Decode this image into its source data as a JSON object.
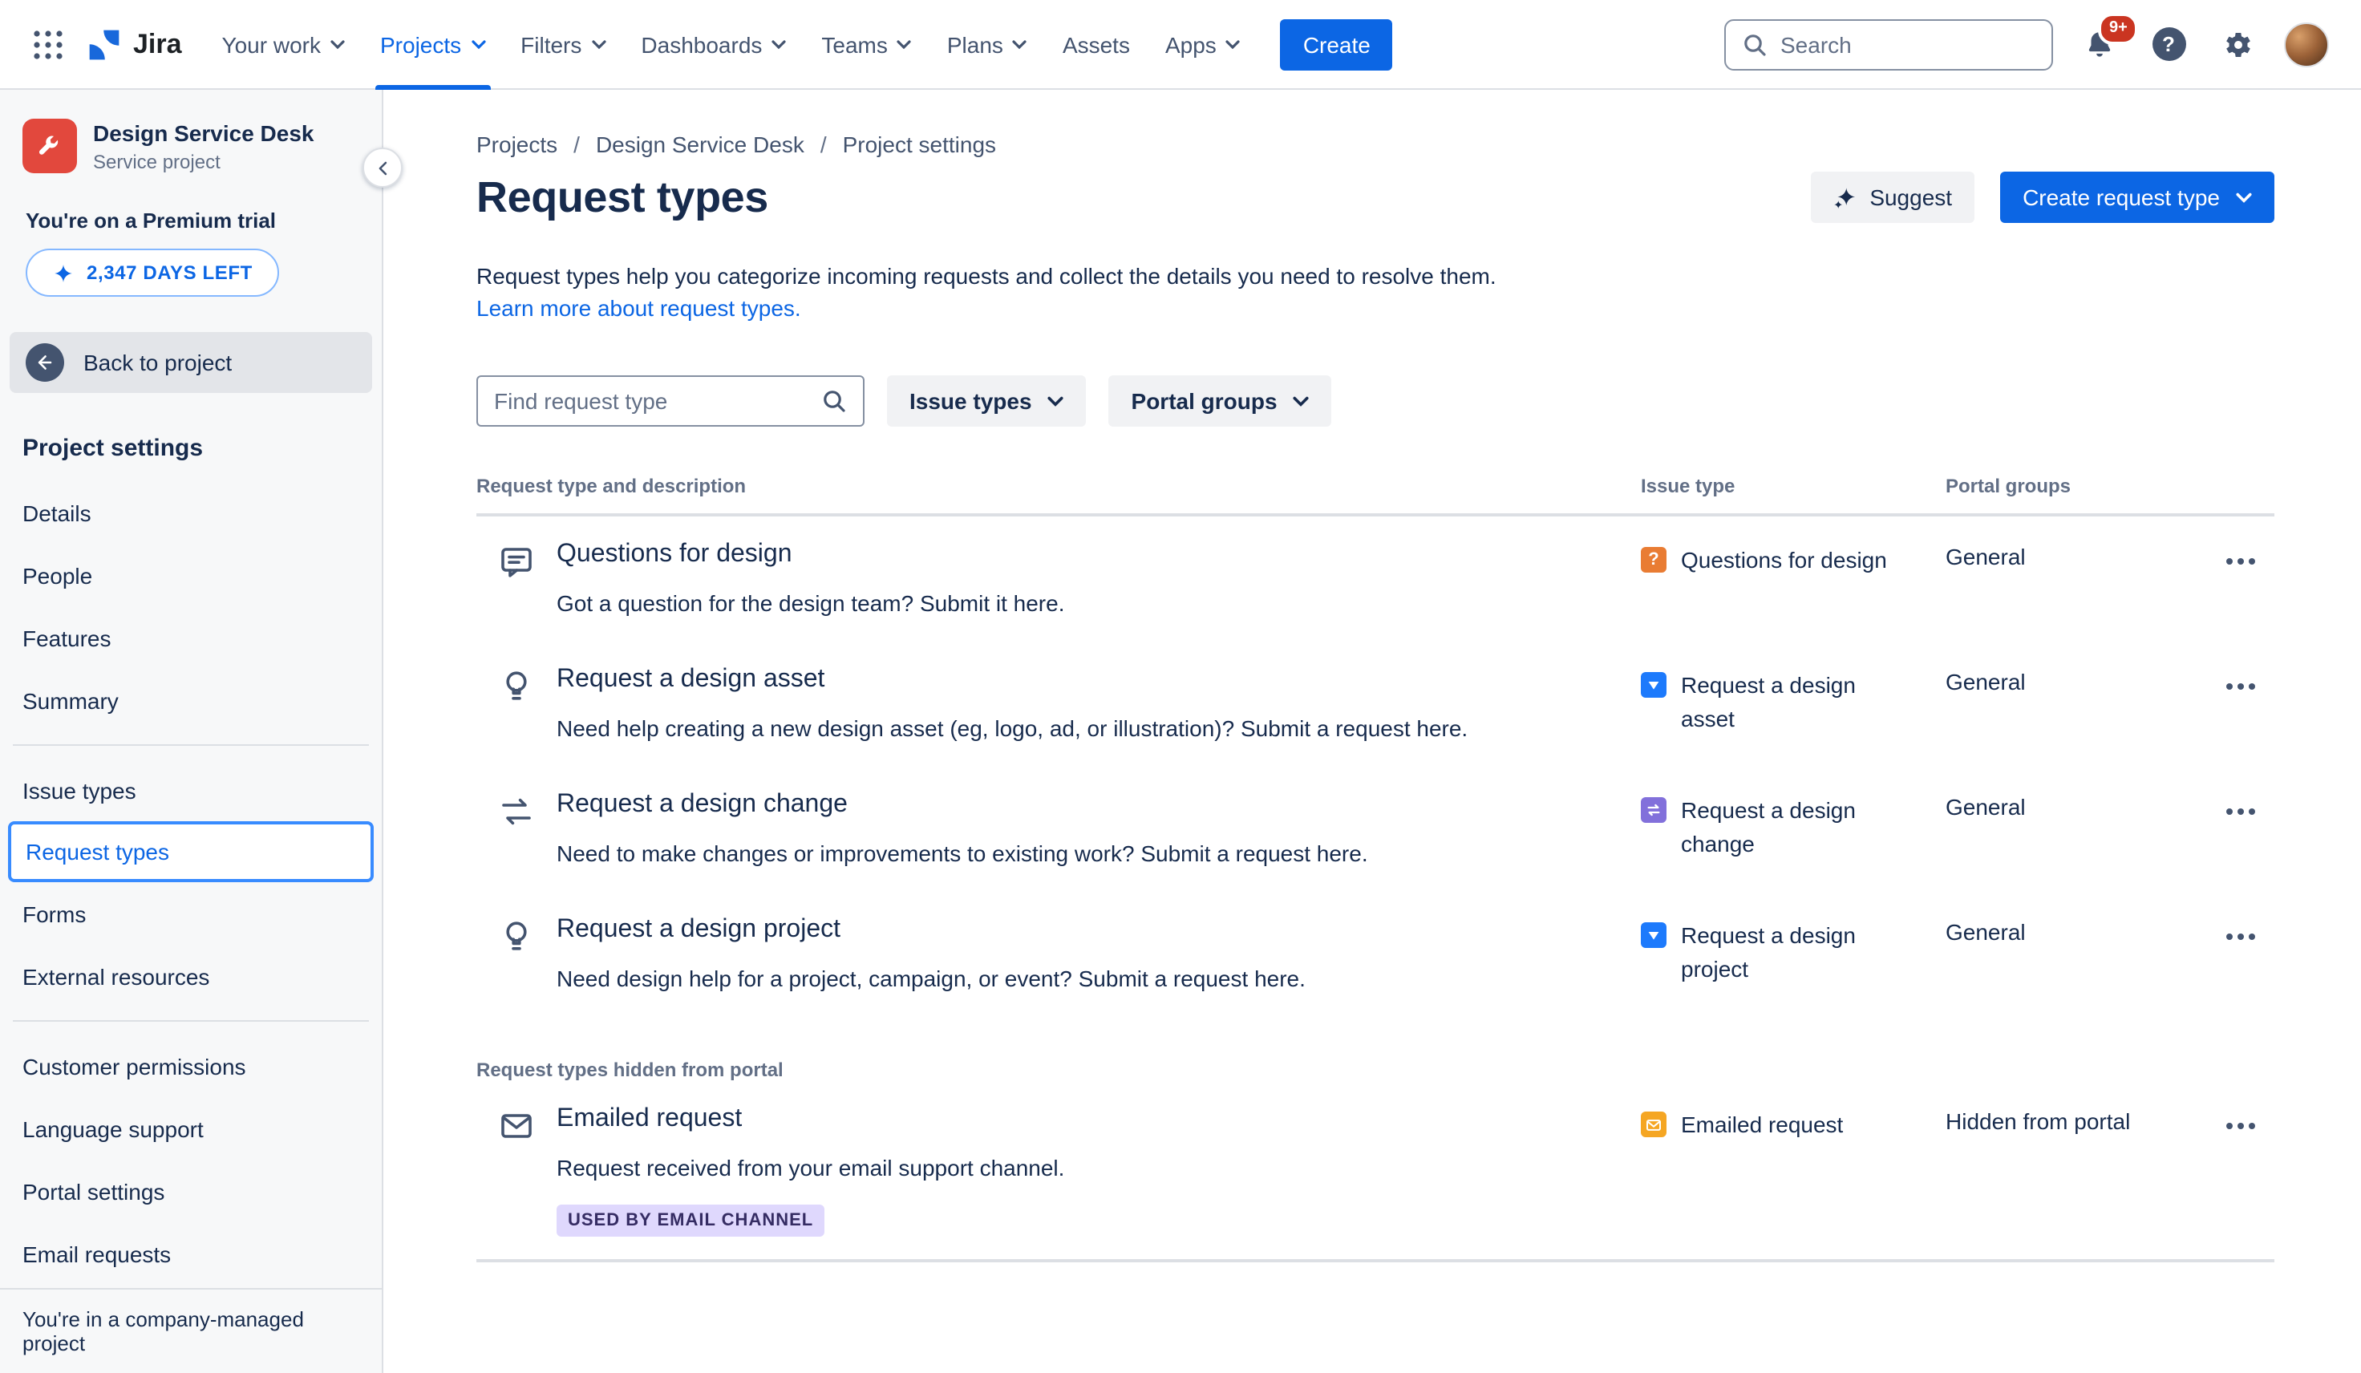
{
  "topbar": {
    "logo_text": "Jira",
    "nav": [
      {
        "label": "Your work"
      },
      {
        "label": "Projects"
      },
      {
        "label": "Filters"
      },
      {
        "label": "Dashboards"
      },
      {
        "label": "Teams"
      },
      {
        "label": "Plans"
      },
      {
        "label": "Assets"
      },
      {
        "label": "Apps"
      }
    ],
    "create_label": "Create",
    "search_placeholder": "Search",
    "notification_count": "9+"
  },
  "sidebar": {
    "project_name": "Design Service Desk",
    "project_type": "Service project",
    "trial_text": "You're on a Premium trial",
    "trial_days_label": "2,347 DAYS LEFT",
    "back_label": "Back to project",
    "settings_heading": "Project settings",
    "nav_groups": [
      {
        "items": [
          {
            "label": "Details"
          },
          {
            "label": "People"
          },
          {
            "label": "Features"
          },
          {
            "label": "Summary"
          }
        ]
      },
      {
        "items": [
          {
            "label": "Issue types"
          },
          {
            "label": "Request types",
            "selected": true
          },
          {
            "label": "Forms"
          },
          {
            "label": "External resources"
          }
        ]
      },
      {
        "items": [
          {
            "label": "Customer permissions"
          },
          {
            "label": "Language support"
          },
          {
            "label": "Portal settings"
          },
          {
            "label": "Email requests"
          }
        ]
      }
    ],
    "footer_note": "You're in a company-managed project"
  },
  "main": {
    "breadcrumbs": [
      {
        "label": "Projects"
      },
      {
        "label": "Design Service Desk"
      },
      {
        "label": "Project settings"
      }
    ],
    "title": "Request types",
    "suggest_label": "Suggest",
    "create_request_label": "Create request type",
    "intro": "Request types help you categorize incoming requests and collect the details you need to resolve them.",
    "learn_more_link": "Learn more about request types.",
    "filters": {
      "find_placeholder": "Find request type",
      "issue_types_label": "Issue types",
      "portal_groups_label": "Portal groups"
    },
    "table": {
      "headers": [
        "Request type and description",
        "Issue type",
        "Portal groups"
      ],
      "rows": [
        {
          "name": "Questions for design",
          "description": "Got a question for the design team? Submit it here.",
          "issue_type": "Questions for design",
          "issue_icon_glyph": "?",
          "portal_group": "General"
        },
        {
          "name": "Request a design asset",
          "description": "Need help creating a new design asset (eg, logo, ad, or illustration)? Submit a request here.",
          "issue_type": "Request a design asset",
          "portal_group": "General"
        },
        {
          "name": "Request a design change",
          "description": "Need to make changes or improvements to existing work? Submit a request here.",
          "issue_type": "Request a design change",
          "portal_group": "General"
        },
        {
          "name": "Request a design project",
          "description": "Need design help for a project, campaign, or event? Submit a request here.",
          "issue_type": "Request a design project",
          "portal_group": "General"
        }
      ],
      "hidden_section_label": "Request types hidden from portal",
      "hidden_rows": [
        {
          "name": "Emailed request",
          "description": "Request received from your email support channel.",
          "badge": "USED BY EMAIL CHANNEL",
          "issue_type": "Emailed request",
          "portal_group": "Hidden from portal"
        }
      ]
    }
  },
  "colors": {
    "brand_blue": "#0C66E4",
    "active_nav_blue": "#0C66E4",
    "notification_red": "#CA3521",
    "project_icon_red": "#E2483D",
    "issue_question_orange": "#E97C33",
    "issue_asset_blue": "#1D7AFC",
    "issue_change_purple": "#8270DB",
    "issue_email_amber": "#F5A623",
    "badge_purple_bg": "#DFD8FD",
    "badge_purple_text": "#352C63",
    "selected_item_border": "#388BFF"
  }
}
